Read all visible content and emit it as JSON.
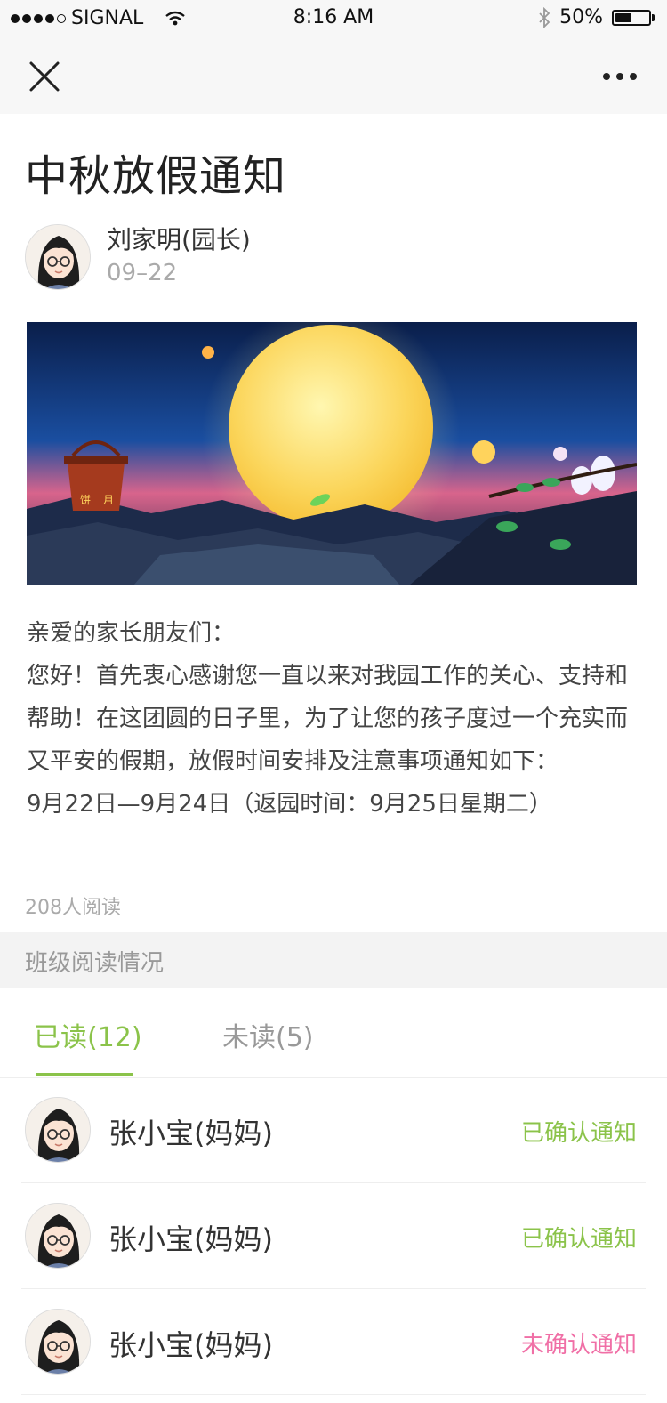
{
  "status_bar": {
    "carrier": "SIGNAL",
    "time": "8:16 AM",
    "battery": "50%",
    "battery_level": 0.5
  },
  "notice": {
    "title": "中秋放假通知",
    "author": "刘家明(园长)",
    "date": "09–22",
    "banner_labels": [
      "饼",
      "月"
    ],
    "body": [
      "亲爱的家长朋友们：",
      "您好！首先衷心感谢您一直以来对我园工作的关心、支持和帮助！在这团圆的日子里，为了让您的孩子度过一个充实而又平安的假期，放假时间安排及注意事项通知如下：",
      "9月22日—9月24日（返园时间：9月25日星期二）"
    ],
    "read_count": "208人阅读"
  },
  "class_reading": {
    "section_title": "班级阅读情况",
    "tabs": {
      "read": "已读(12)",
      "unread": "未读(5)"
    },
    "readers": [
      {
        "name": "张小宝(妈妈)",
        "status": "已确认通知"
      },
      {
        "name": "张小宝(妈妈)",
        "status": "已确认通知"
      },
      {
        "name": "张小宝(妈妈)",
        "status": "未确认通知"
      }
    ]
  },
  "colors": {
    "accent_green": "#8bc34a",
    "pending_pink": "#f06fa6"
  }
}
